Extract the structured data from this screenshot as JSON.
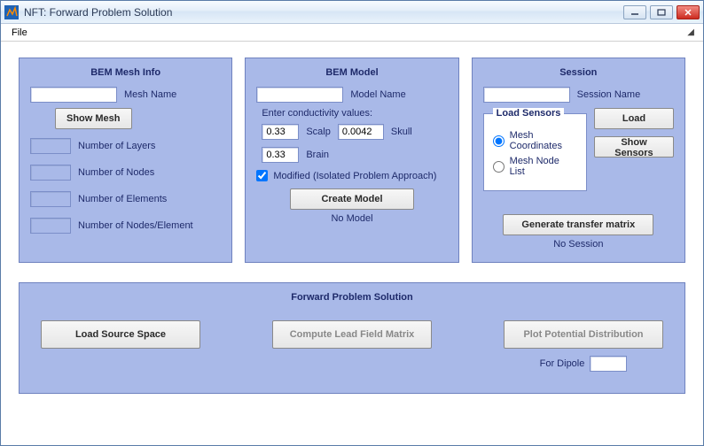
{
  "window": {
    "title": "NFT: Forward Problem Solution"
  },
  "menubar": {
    "file": "File"
  },
  "mesh_panel": {
    "title": "BEM Mesh Info",
    "mesh_name_label": "Mesh Name",
    "mesh_name_value": "",
    "show_mesh_label": "Show Mesh",
    "fields": {
      "num_layers_label": "Number of Layers",
      "num_layers_value": "",
      "num_nodes_label": "Number of Nodes",
      "num_nodes_value": "",
      "num_elements_label": "Number of Elements",
      "num_elements_value": "",
      "num_nodes_per_elem_label": "Number of Nodes/Element",
      "num_nodes_per_elem_value": ""
    }
  },
  "model_panel": {
    "title": "BEM Model",
    "model_name_label": "Model Name",
    "model_name_value": "",
    "enter_cond_label": "Enter conductivity values:",
    "scalp": {
      "label": "Scalp",
      "value": "0.33"
    },
    "skull": {
      "label": "Skull",
      "value": "0.0042"
    },
    "brain": {
      "label": "Brain",
      "value": "0.33"
    },
    "modified_label": "Modified (Isolated Problem Approach)",
    "modified_checked": true,
    "create_model_label": "Create Model",
    "status": "No Model"
  },
  "session_panel": {
    "title": "Session",
    "session_name_label": "Session Name",
    "session_name_value": "",
    "load_sensors_legend": "Load Sensors",
    "radio_mesh_coords": "Mesh Coordinates",
    "radio_node_list": "Mesh Node List",
    "radio_selected": "mesh_coords",
    "load_label": "Load",
    "show_sensors_label": "Show Sensors",
    "gen_transfer_label": "Generate transfer matrix",
    "status": "No Session"
  },
  "forward_panel": {
    "title": "Forward Problem Solution",
    "load_source_label": "Load Source Space",
    "compute_lfm_label": "Compute Lead Field Matrix",
    "plot_pot_label": "Plot Potential Distribution",
    "for_dipole_label": "For Dipole",
    "for_dipole_value": ""
  }
}
